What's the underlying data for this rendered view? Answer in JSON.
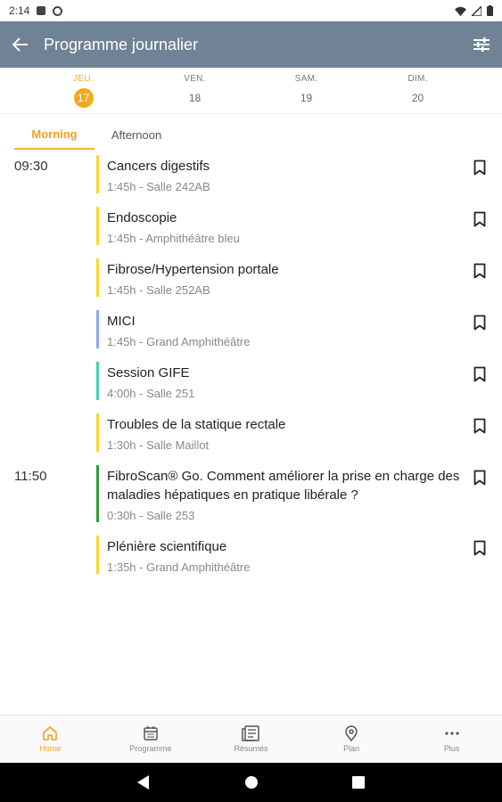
{
  "status_bar": {
    "time": "2:14"
  },
  "app_bar": {
    "title": "Programme journalier"
  },
  "days": [
    {
      "name": "JEU.",
      "number": "17",
      "active": true
    },
    {
      "name": "VEN.",
      "number": "18",
      "active": false
    },
    {
      "name": "SAM.",
      "number": "19",
      "active": false
    },
    {
      "name": "DIM.",
      "number": "20",
      "active": false
    }
  ],
  "tabs": {
    "morning": "Morning",
    "afternoon": "Afternoon"
  },
  "sessions": [
    {
      "time": "09:30",
      "title": "Cancers digestifs",
      "meta": "1:45h - Salle 242AB",
      "color": "#f7d92b"
    },
    {
      "time": "",
      "title": "Endoscopie",
      "meta": "1:45h - Amphithéâtre bleu",
      "color": "#f7d92b"
    },
    {
      "time": "",
      "title": "Fibrose/Hypertension portale",
      "meta": "1:45h - Salle 252AB",
      "color": "#f7d92b"
    },
    {
      "time": "",
      "title": "MICI",
      "meta": "1:45h - Grand Amphithéâtre",
      "color": "#8fa6ec"
    },
    {
      "time": "",
      "title": "Session GIFE",
      "meta": "4:00h - Salle 251",
      "color": "#40d3b0"
    },
    {
      "time": "",
      "title": "Troubles de la statique rectale",
      "meta": "1:30h - Salle Maillot",
      "color": "#f7d92b"
    },
    {
      "time": "11:50",
      "title": "FibroScan® Go. Comment améliorer la prise en charge des maladies hépatiques en pratique libérale ?",
      "meta": "0:30h - Salle 253",
      "color": "#2e9a3c"
    },
    {
      "time": "",
      "title": "Plénière scientifique",
      "meta": "1:35h - Grand Amphithéâtre",
      "color": "#f7d92b"
    }
  ],
  "bottom_nav": [
    {
      "label": "Home",
      "icon": "home-icon",
      "active": true
    },
    {
      "label": "Programme",
      "icon": "calendar-icon",
      "active": false
    },
    {
      "label": "Résumés",
      "icon": "document-list-icon",
      "active": false
    },
    {
      "label": "Plan",
      "icon": "map-pin-icon",
      "active": false
    },
    {
      "label": "Plus",
      "icon": "more-icon",
      "active": false
    }
  ],
  "colors": {
    "app_bar": "#6f8296",
    "accent": "#f5a922"
  }
}
